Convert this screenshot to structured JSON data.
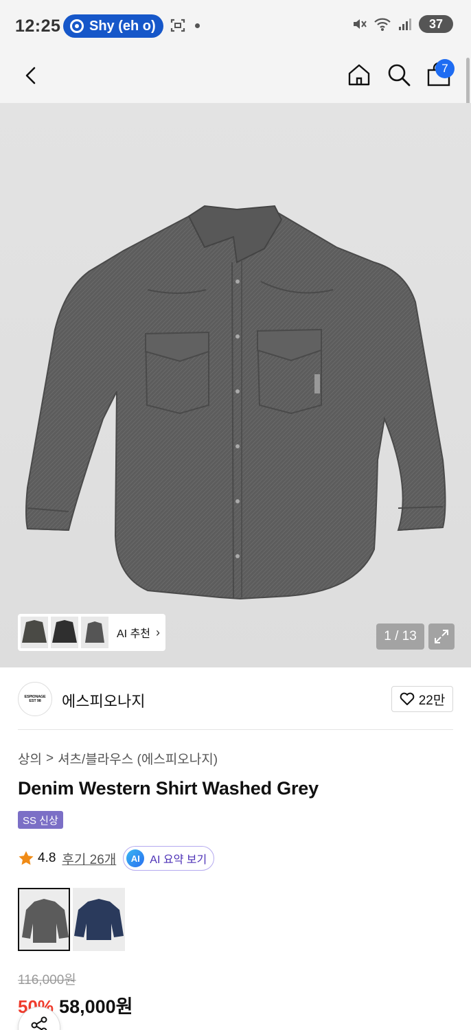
{
  "status_bar": {
    "time": "12:25",
    "pill_label": "Shy (eh o)",
    "battery": "37"
  },
  "nav": {
    "cart_count": "7"
  },
  "gallery": {
    "ai_recommend_label": "AI 추천",
    "ai_recommend_chevron": "›",
    "counter": "1 / 13"
  },
  "brand": {
    "name": "에스피오나지",
    "logo_line1": "ESPIONAGE",
    "logo_line2": "EST 98",
    "likes": "22만"
  },
  "breadcrumb": {
    "category": "상의",
    "separator": ">",
    "subcategory": "셔츠/블라우스 (에스피오나지)"
  },
  "product": {
    "title": "Denim Western Shirt Washed Grey",
    "tag": "SS 신상",
    "rating": "4.8",
    "reviews": "후기 26개",
    "ai_chip": "AI",
    "ai_summary": "AI 요약 보기",
    "original_price": "116,000원",
    "discount": "50%",
    "price": "58,000원"
  },
  "swatches": [
    {
      "name": "washed-grey",
      "color": "#5b5b5b"
    },
    {
      "name": "navy",
      "color": "#2a3a5c"
    }
  ],
  "colors": {
    "accent_blue": "#1e6cf2",
    "discount_red": "#ef3b2c",
    "tag_purple": "#7b6fc6"
  }
}
